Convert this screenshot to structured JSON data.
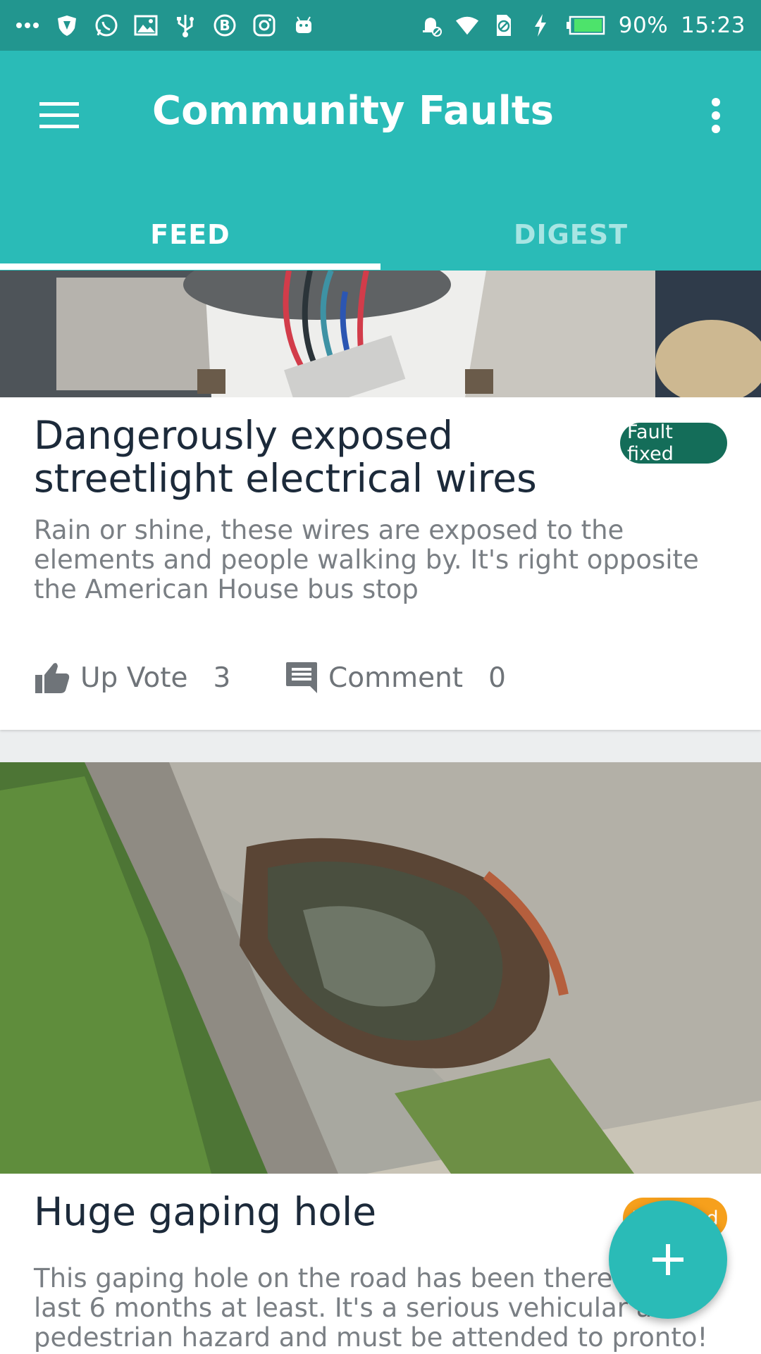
{
  "status_bar": {
    "battery": "90%",
    "time": "15:23",
    "left_icons": [
      "more-icon",
      "shield-icon",
      "whatsapp-icon",
      "image-icon",
      "usb-icon",
      "b-icon",
      "instagram-icon",
      "android-icon"
    ],
    "right_icons": [
      "alarm-off-icon",
      "wifi-icon",
      "no-sim-icon",
      "charging-icon",
      "battery-icon"
    ]
  },
  "app_bar": {
    "title": "Community Faults",
    "color": "#2abbb7"
  },
  "tabs": [
    {
      "label": "FEED",
      "selected": true
    },
    {
      "label": "DIGEST",
      "selected": false
    }
  ],
  "feed": [
    {
      "title": "Dangerously exposed streetlight electrical wires",
      "status": "Fault fixed",
      "status_color": "#146d59",
      "description": "Rain or shine, these wires are exposed to the elements and people walking by. It's right opposite the American House bus stop",
      "upvote_label": "Up Vote",
      "upvote_count": "3",
      "comment_label": "Comment",
      "comment_count": "0"
    },
    {
      "title": "Huge gaping hole",
      "status": "Reported",
      "status_color": "#f6a01c",
      "description": "This gaping hole on the road has been there for last 6 months at least. It's a serious vehicular and pedestrian hazard and must be attended to pronto!"
    }
  ],
  "fab": {
    "icon": "plus-icon"
  }
}
